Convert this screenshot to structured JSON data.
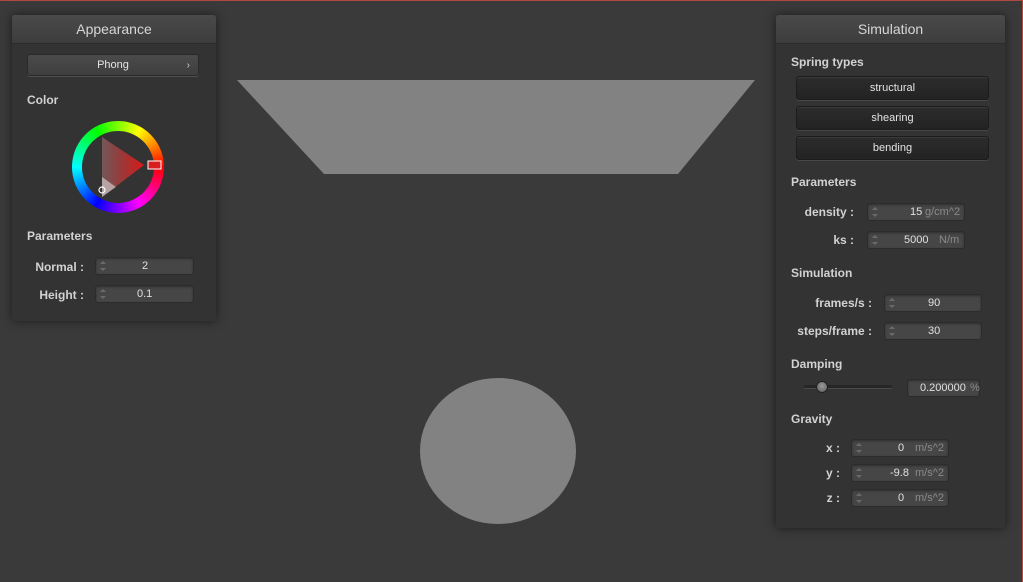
{
  "colors": {
    "background": "#3a3a3a",
    "panel": "#333333",
    "scene_shape": "#828282",
    "selected_color": "#d81e1e"
  },
  "appearance": {
    "title": "Appearance",
    "shader_popup": "Phong",
    "popup_arrow": "›",
    "color_label": "Color",
    "parameters_label": "Parameters",
    "normal_label": "Normal :",
    "normal_value": "2",
    "height_label": "Height :",
    "height_value": "0.1"
  },
  "simulation": {
    "title": "Simulation",
    "spring_types_label": "Spring types",
    "spring_buttons": [
      "structural",
      "shearing",
      "bending"
    ],
    "parameters_label": "Parameters",
    "density_label": "density :",
    "density_value": "15",
    "density_unit": "g/cm^2",
    "ks_label": "ks :",
    "ks_value": "5000",
    "ks_unit": "N/m",
    "simulation_label": "Simulation",
    "fps_label": "frames/s :",
    "fps_value": "90",
    "steps_label": "steps/frame :",
    "steps_value": "30",
    "damping_label": "Damping",
    "damping_slider_level": 0.2,
    "damping_value": "0.200000",
    "damping_unit": "%",
    "gravity_label": "Gravity",
    "gx_label": "x :",
    "gx_value": "0",
    "gy_label": "y :",
    "gy_value": "-9.8",
    "gz_label": "z :",
    "gz_value": "0",
    "gravity_unit": "m/s^2"
  }
}
